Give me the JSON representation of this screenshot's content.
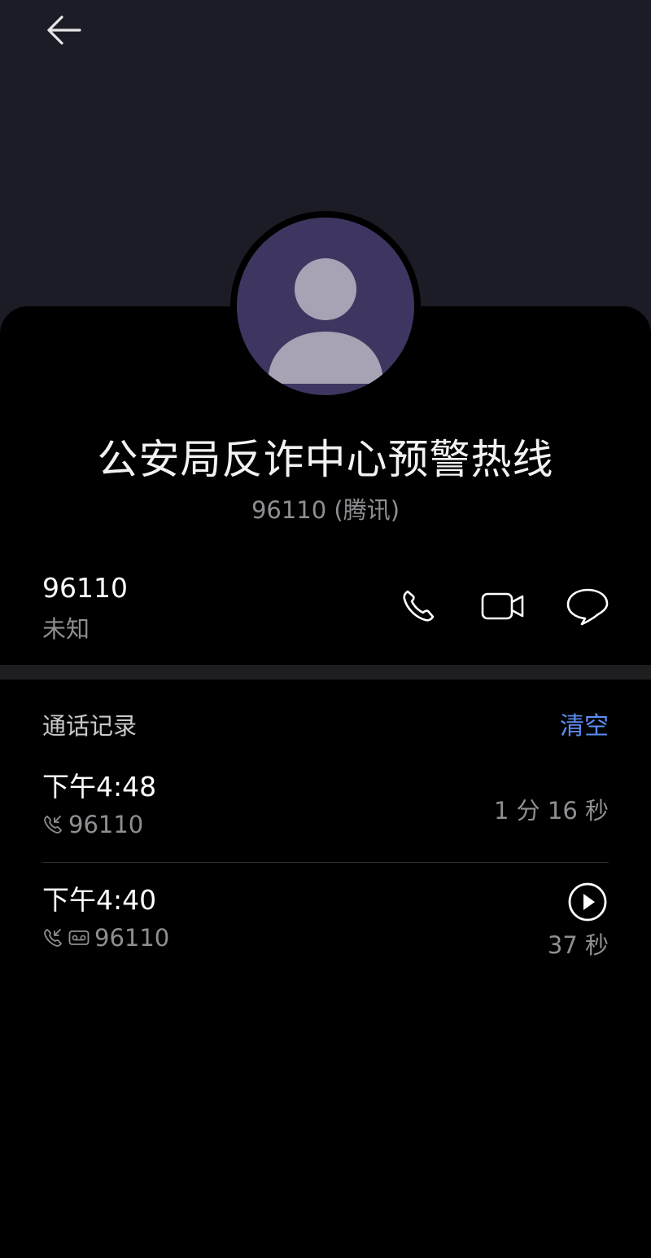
{
  "header": {
    "back_icon": "arrow-left-icon"
  },
  "contact": {
    "name": "公安局反诈中心预警热线",
    "subtitle": "96110 (腾讯)",
    "avatar_icon": "person-avatar-icon"
  },
  "number_entry": {
    "number": "96110",
    "type": "未知",
    "actions": [
      {
        "icon": "phone-icon"
      },
      {
        "icon": "video-camera-icon"
      },
      {
        "icon": "message-bubble-icon"
      }
    ]
  },
  "call_history": {
    "title": "通话记录",
    "clear_label": "清空",
    "records": [
      {
        "time": "下午4:48",
        "number": "96110",
        "duration": "1 分 16 秒",
        "direction_icon": "incoming-call-icon"
      },
      {
        "time": "下午4:40",
        "number": "96110",
        "duration": "37 秒",
        "direction_icon": "incoming-call-icon",
        "extra_icon": "voicemail-icon",
        "play_icon": "play-icon"
      }
    ]
  },
  "colors": {
    "top_background": "#1c1c26",
    "background": "#000000",
    "avatar_background": "#3e3660",
    "avatar_figure": "#a7a3b4",
    "accent": "#5b8def",
    "secondary_text": "#8f8f93"
  }
}
